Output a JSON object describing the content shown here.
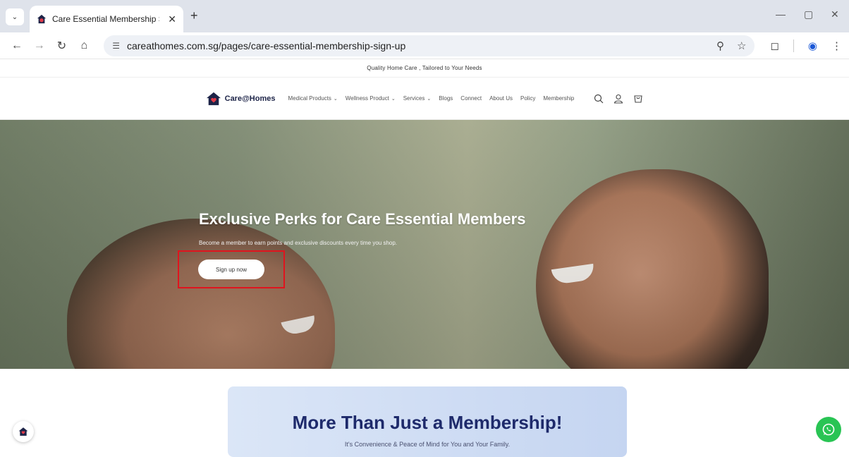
{
  "browser": {
    "tab_title": "Care Essential Membership Sign",
    "tab_close": "✕",
    "new_tab": "+",
    "url": "careathomes.com.sg/pages/care-essential-membership-sign-up",
    "window_controls": [
      "—",
      "▢",
      "✕"
    ]
  },
  "announcement": "Quality Home Care , Tailored to Your Needs",
  "header": {
    "brand": "Care@Homes",
    "nav": [
      {
        "label": "Medical Products",
        "has_dropdown": true
      },
      {
        "label": "Wellness Product",
        "has_dropdown": true
      },
      {
        "label": "Services",
        "has_dropdown": true
      },
      {
        "label": "Blogs",
        "has_dropdown": false
      },
      {
        "label": "Connect",
        "has_dropdown": false
      },
      {
        "label": "About Us",
        "has_dropdown": false
      },
      {
        "label": "Policy",
        "has_dropdown": false
      },
      {
        "label": "Membership",
        "has_dropdown": false
      }
    ]
  },
  "hero": {
    "title": "Exclusive Perks for Care Essential Members",
    "subtitle": "Become a member to earn points and exclusive discounts every time you shop.",
    "cta_label": "Sign up now"
  },
  "membership_card": {
    "title": "More Than Just a Membership!",
    "subtitle": "It's Convenience & Peace of Mind for You and Your Family."
  },
  "colors": {
    "brand_navy": "#1d2448",
    "highlight_red": "#e0141e",
    "whatsapp_green": "#29c454"
  }
}
